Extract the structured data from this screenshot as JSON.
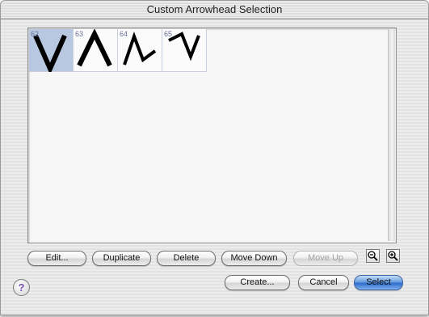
{
  "window": {
    "title": "Custom Arrowhead Selection"
  },
  "arrowheads": [
    {
      "number": "62",
      "shape": "v-arrowhead",
      "selected": true
    },
    {
      "number": "63",
      "shape": "caret-arrowhead",
      "selected": false
    },
    {
      "number": "64",
      "shape": "zigzag-up-arrowhead",
      "selected": false
    },
    {
      "number": "65",
      "shape": "zigzag-down-arrowhead",
      "selected": false
    }
  ],
  "buttons": {
    "edit": "Edit...",
    "duplicate": "Duplicate",
    "delete": "Delete",
    "move_down": "Move Down",
    "move_up": "Move Up",
    "create": "Create...",
    "cancel": "Cancel",
    "select": "Select",
    "help": "?"
  },
  "icons": {
    "zoom_out": "zoom-out-icon",
    "zoom_in": "zoom-in-icon"
  },
  "colors": {
    "selection": "#b8c8e0",
    "default_button": "#3f7fd8",
    "cell_number": "#6a6f9a"
  }
}
